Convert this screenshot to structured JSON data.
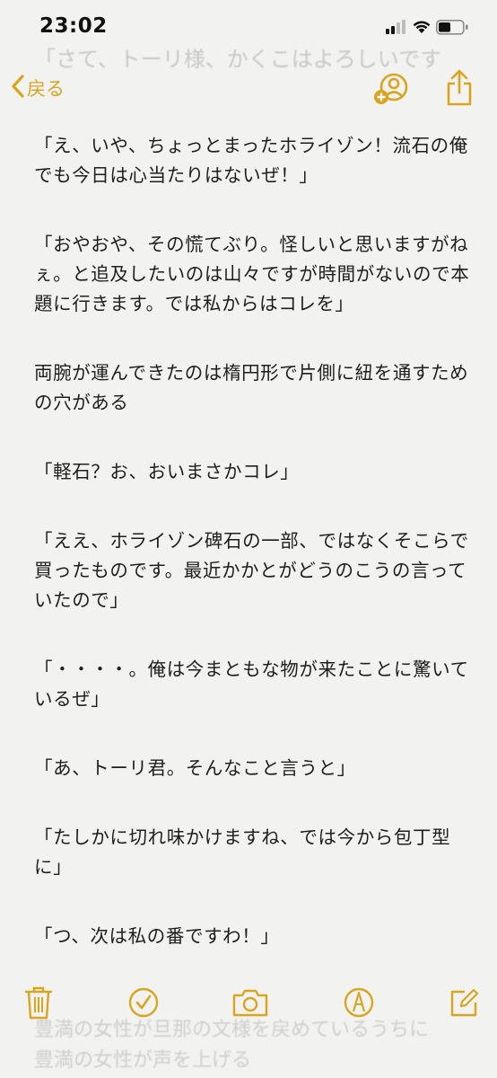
{
  "status": {
    "time": "23:02"
  },
  "ghost_top": "「さて、トーリ様、かくこはよろしいです",
  "nav": {
    "back_label": "戻る",
    "share_person_icon": "person-add-icon",
    "share_icon": "share-icon"
  },
  "paragraphs": [
    "「え、いや、ちょっとまったホライゾン！流石の俺でも今日は心当たりはないぜ！」",
    "「おやおや、その慌てぶり。怪しいと思いますがねぇ。と追及したいのは山々ですが時間がないので本題に行きます。では私からはコレを」",
    "両腕が運んできたのは楕円形で片側に紐を通すための穴がある",
    "「軽石？お、おいまさかコレ」",
    "「ええ、ホライゾン碑石の一部、ではなくそこらで買ったものです。最近かかとがどうのこうの言っていたので」",
    "「・・・・。俺は今まともな物が来たことに驚いているぜ」",
    "「あ、トーリ君。そんなこと言うと」",
    "「たしかに切れ味かけますね、では今から包丁型に」",
    "「つ、次は私の番ですわ！」"
  ],
  "ghost_bottom": [
    "豊満の女性が旦那の文様を戻めているうちに",
    "豊満の女性が声を上げる"
  ],
  "toolbar": {
    "items": [
      "trash-icon",
      "checklist-icon",
      "camera-icon",
      "markup-icon",
      "compose-icon"
    ]
  },
  "colors": {
    "accent": "#d9a521",
    "background": "#f2f2f0",
    "text": "#1e1e1e"
  }
}
